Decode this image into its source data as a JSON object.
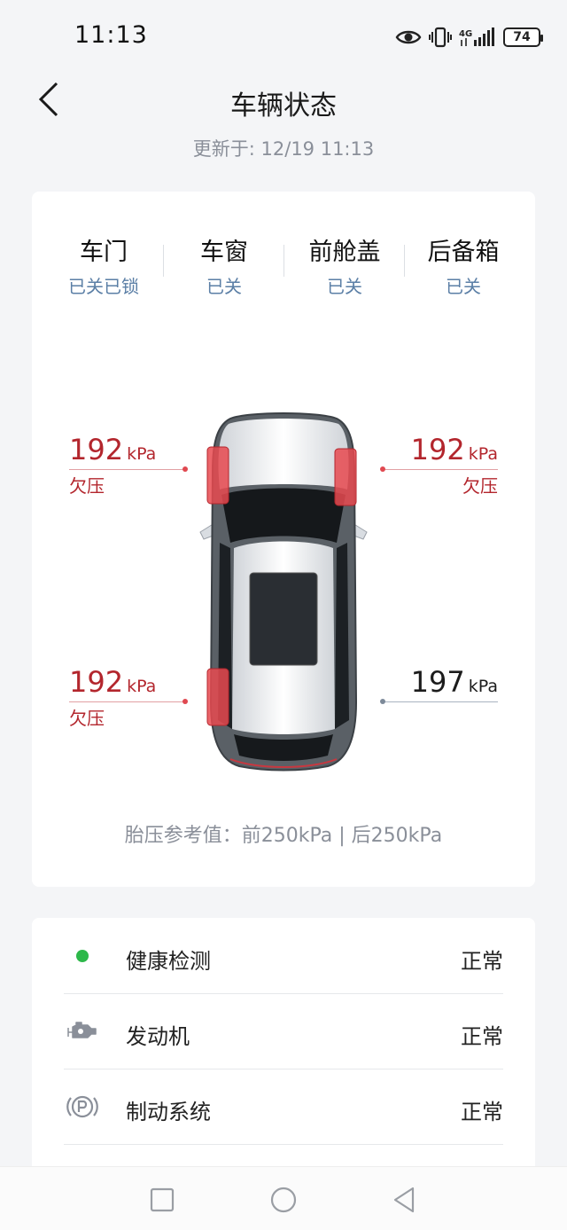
{
  "status_bar": {
    "time": "11:13",
    "battery": "74",
    "network": "4G"
  },
  "header": {
    "title": "车辆状态",
    "updated": "更新于: 12/19 11:13"
  },
  "closures": [
    {
      "label": "车门",
      "value": "已关已锁"
    },
    {
      "label": "车窗",
      "value": "已关"
    },
    {
      "label": "前舱盖",
      "value": "已关"
    },
    {
      "label": "后备箱",
      "value": "已关"
    }
  ],
  "tires": {
    "unit": "kPa",
    "front_left": {
      "value": "192",
      "status": "欠压"
    },
    "front_right": {
      "value": "192",
      "status": "欠压"
    },
    "rear_left": {
      "value": "192",
      "status": "欠压"
    },
    "rear_right": {
      "value": "197",
      "status": ""
    }
  },
  "reference": "胎压参考值：前250kPa | 后250kPa",
  "list": [
    {
      "name": "健康检测",
      "state": "正常",
      "icon": "status-dot-icon"
    },
    {
      "name": "发动机",
      "state": "正常",
      "icon": "engine-icon"
    },
    {
      "name": "制动系统",
      "state": "正常",
      "icon": "parking-brake-icon"
    }
  ],
  "colors": {
    "warning": "#b3262d",
    "ok": "#2db84a",
    "accent": "#5b7fa6"
  }
}
